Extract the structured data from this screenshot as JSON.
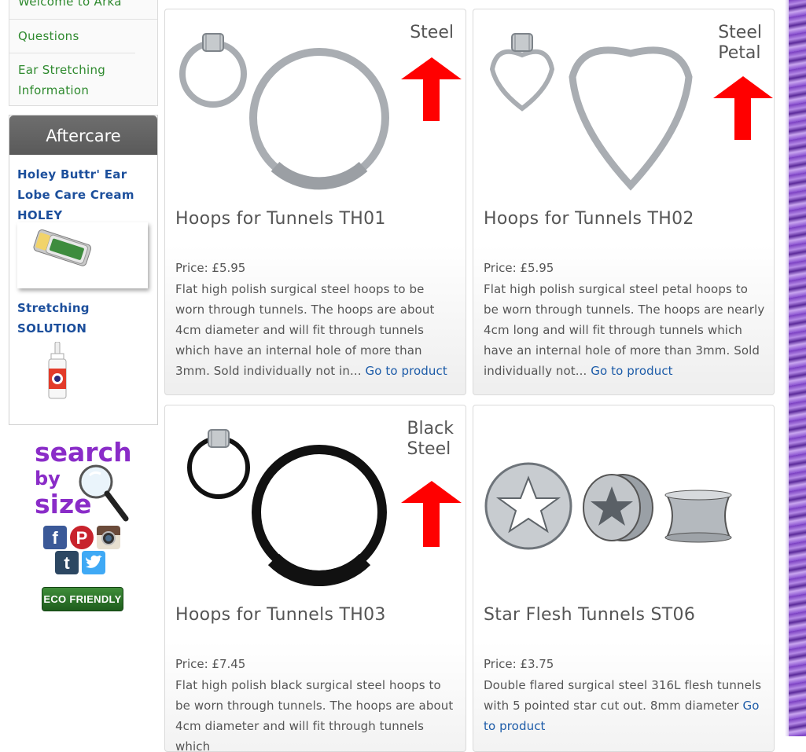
{
  "sidebar": {
    "nav": [
      {
        "label": "Welcome to Arka"
      },
      {
        "label": "Questions"
      },
      {
        "label": "Ear Stretching Information"
      }
    ],
    "aftercare": {
      "title": "Aftercare",
      "product1": "Holey Buttr' Ear Lobe Care Cream HOLEY",
      "product2": "Stretching SOLUTION"
    },
    "search_by_size": {
      "line1": "search",
      "line2": "by",
      "line3": "size"
    },
    "social_icons": [
      "facebook-icon",
      "pinterest-icon",
      "instagram-icon",
      "tumblr-icon",
      "twitter-icon"
    ],
    "eco_badge": "ECO FRIENDLY"
  },
  "products": [
    {
      "variant": "Steel",
      "title": "Hoops for Tunnels TH01",
      "price": "Price: £5.95",
      "description": "Flat high polish surgical steel hoops to be worn through tunnels. The hoops are about 4cm diameter and will fit through tunnels which have an internal hole of more than 3mm. Sold individually not in...",
      "link": "Go to product"
    },
    {
      "variant": "Steel\nPetal",
      "title": "Hoops for Tunnels TH02",
      "price": "Price: £5.95",
      "description": "Flat high polish surgical steel petal hoops to be worn through tunnels. The hoops are nearly 4cm long and will fit through tunnels which have an internal hole of more than 3mm. Sold individually not...",
      "link": "Go to product"
    },
    {
      "variant": "Black\nSteel",
      "title": "Hoops for Tunnels TH03",
      "price": "Price: £7.45",
      "description": "Flat high polish black surgical steel hoops to be worn through tunnels. The hoops are about 4cm diameter and will fit through tunnels which",
      "link": ""
    },
    {
      "variant": "",
      "title": "Star Flesh Tunnels ST06",
      "price": "Price: £3.75",
      "description": "Double flared surgical steel 316L flesh tunnels with 5 pointed star cut out. 8mm diameter",
      "link": "Go to product"
    }
  ],
  "colors": {
    "link": "#1c5ba8",
    "nav_green": "#2f8a2f",
    "arrow_red": "#ff0000",
    "purple_border": "#7a3fc0"
  }
}
